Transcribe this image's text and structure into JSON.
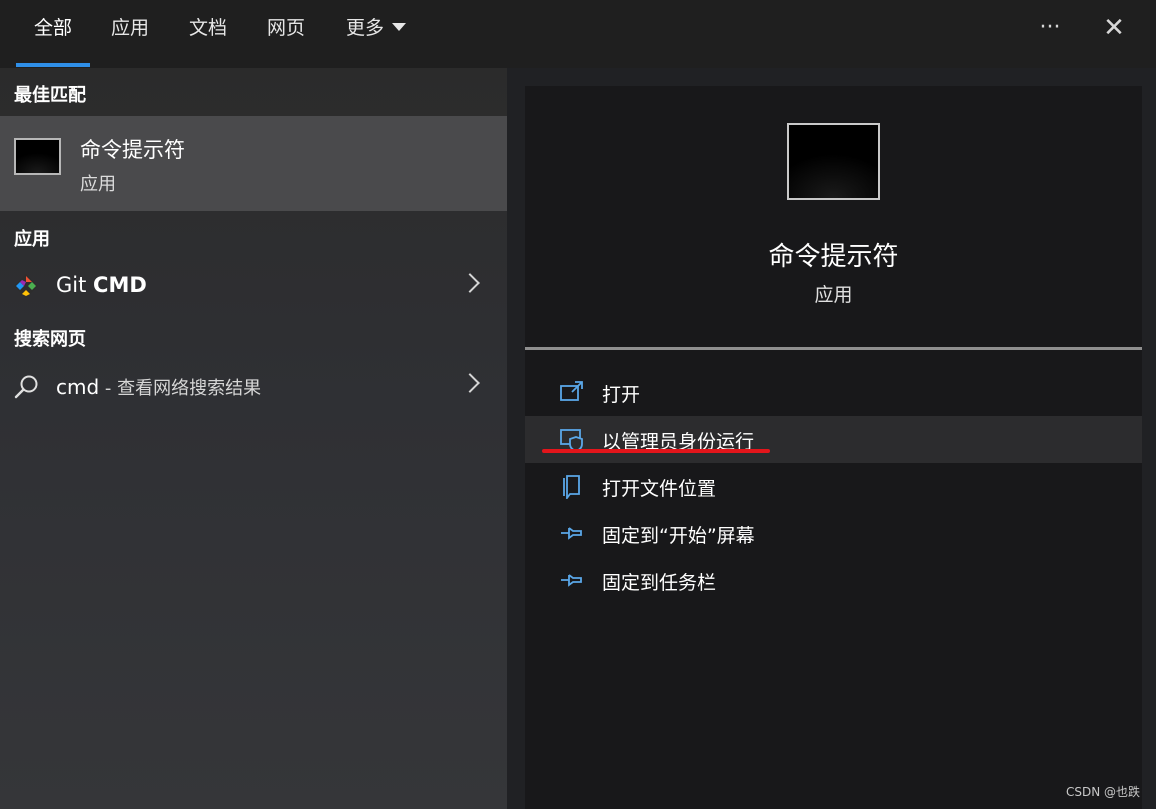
{
  "tabs": [
    {
      "label": "全部",
      "active": true
    },
    {
      "label": "应用",
      "active": false
    },
    {
      "label": "文档",
      "active": false
    },
    {
      "label": "网页",
      "active": false
    },
    {
      "label": "更多",
      "active": false
    }
  ],
  "top_actions": {
    "more": "···",
    "close": "✕"
  },
  "left": {
    "best_match_heading": "最佳匹配",
    "best_match": {
      "title": "命令提示符",
      "subtitle": "应用"
    },
    "apps_heading": "应用",
    "app_item": {
      "name_regular": "Git ",
      "name_bold": "CMD"
    },
    "web_heading": "搜索网页",
    "web_item": {
      "query": "cmd",
      "suffix": " - 查看网络搜索结果"
    }
  },
  "right": {
    "app_title": "命令提示符",
    "app_type": "应用",
    "actions": [
      {
        "label": "打开",
        "icon": "open-icon"
      },
      {
        "label": "以管理员身份运行",
        "icon": "shield-icon"
      },
      {
        "label": "打开文件位置",
        "icon": "file-location-icon"
      },
      {
        "label": "固定到“开始”屏幕",
        "icon": "pin-icon"
      },
      {
        "label": "固定到任务栏",
        "icon": "pin-icon"
      }
    ]
  },
  "colors": {
    "accent": "#2f8fe8",
    "icon_blue": "#5aa7e8",
    "highlight": "#e3151b"
  },
  "watermark": "CSDN @也跌"
}
